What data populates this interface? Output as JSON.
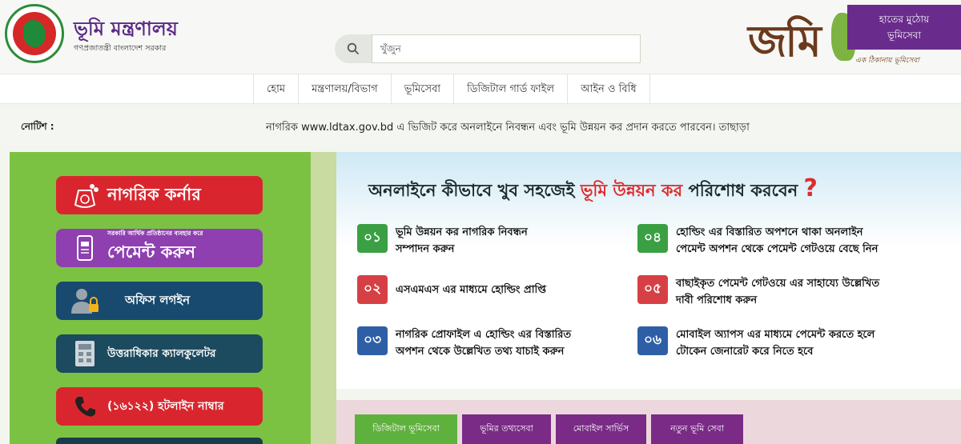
{
  "header": {
    "ministry_name": "ভূমি মন্ত্রণালয়",
    "ministry_subtitle": "গণপ্রজাতন্ত্রী বাংলাদেশ সরকার",
    "search_placeholder": "খুঁজুন",
    "logo_text": "জমি",
    "tagline_line1": "হাতের মুঠোয়",
    "tagline_line2": "ভূমিসেবা",
    "tagline_small": "এক ঠিকানায় ভূমিসেবা"
  },
  "nav": {
    "items": [
      "হোম",
      "মন্ত্রণালয়/বিভাগ",
      "ভূমিসেবা",
      "ডিজিটাল গার্ড ফাইল",
      "আইন ও বিধি"
    ]
  },
  "notice": {
    "label": "নোটিশ :",
    "text": "নাগরিক www.ldtax.gov.bd এ ভিজিট করে অনলাইনে নিবন্ধন এবং ভূমি উন্নয়ন কর প্রদান করতে পারবেন। তাছাড়া"
  },
  "sidebar": {
    "buttons": [
      {
        "label": "নাগরিক কর্নার",
        "icon": "money-bag-icon",
        "color": "#d9262e"
      },
      {
        "label": "পেমেন্ট করুন",
        "sublabel": "সরকারি আর্থিক প্রতিষ্ঠানের ব্যবহার করে",
        "icon": "mobile-payment-icon",
        "color": "#8e3fb0"
      },
      {
        "label": "অফিস লগইন",
        "icon": "user-lock-icon",
        "color": "#174a6e"
      },
      {
        "label": "উত্তরাধিকার ক্যালকুলেটর",
        "icon": "calculator-icon",
        "color": "#1c4a5e"
      },
      {
        "label": "(১৬১২২) হটলাইন নাম্বার",
        "icon": "phone-icon",
        "color": "#d9262e"
      }
    ]
  },
  "info": {
    "title_part1": "অনলাইনে কীভাবে খুব সহজেই ",
    "title_highlight": "ভূমি উন্নয়ন কর",
    "title_part2": " পরিশোধ করবেন",
    "title_mark": "?",
    "steps": [
      {
        "num": "০১",
        "text1": "ভূমি উন্নয়ন কর নাগরিক নিবন্ধন",
        "text2": "সম্পাদন করুন"
      },
      {
        "num": "০২",
        "text1": "এসএমএস এর মাধ্যমে হোল্ডিং প্রাপ্তি",
        "text2": ""
      },
      {
        "num": "০৩",
        "text1": "নাগরিক প্রোফাইল এ হোল্ডিং এর বিস্তারিত",
        "text2": "অপশন থেকে উল্লেখিত তথ্য যাচাই করুন"
      },
      {
        "num": "০৪",
        "text1": "হোল্ডিং এর বিস্তারিত অপশনে থাকা অনলাইন",
        "text2": "পেমেন্ট অপশন থেকে পেমেন্ট গেটওয়ে বেছে নিন"
      },
      {
        "num": "০৫",
        "text1": "বাছাইকৃত পেমেন্ট গেটওয়ে এর সাহায্যে উল্লেখিত",
        "text2": "দাবী পরিশোধ করুন"
      },
      {
        "num": "০৬",
        "text1": "মোবাইল অ্যাপস এর মাধ্যমে পেমেন্ট করতে হলে",
        "text2": "টোকেন জেনারেট করে নিতে হবে"
      }
    ]
  },
  "tabs": [
    "ডিজিটাল ভূমিসেবা",
    "ভূমির তথ্যসেবা",
    "মোবাইল সার্ভিস",
    "নতুন ভূমি সেবা"
  ],
  "colors": {
    "brand_purple": "#6a2c8c",
    "sidebar_green": "#7cc242",
    "accent_red": "#e02b2b",
    "tab_active": "#5fb13d"
  }
}
